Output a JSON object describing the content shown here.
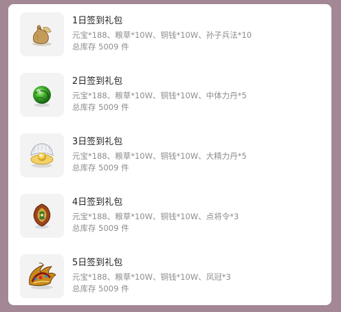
{
  "gifts": [
    {
      "title": "1日签到礼包",
      "contents": "元宝*188、粮草*10W、铜钱*10W、孙子兵法*10",
      "stock": "总库存 5009 件",
      "icon": "grain-sack-icon"
    },
    {
      "title": "2日签到礼包",
      "contents": "元宝*188、粮草*10W、铜钱*10W、中体力丹*5",
      "stock": "总库存 5009 件",
      "icon": "green-pill-icon"
    },
    {
      "title": "3日签到礼包",
      "contents": "元宝*188、粮草*10W、铜钱*10W、大精力丹*5",
      "stock": "总库存 5009 件",
      "icon": "pearl-shell-icon"
    },
    {
      "title": "4日签到礼包",
      "contents": "元宝*188、粮草*10W、铜钱*10W、点将令*3",
      "stock": "总库存 5009 件",
      "icon": "token-badge-icon"
    },
    {
      "title": "5日签到礼包",
      "contents": "元宝*188、粮草*10W、铜钱*10W、凤冠*3",
      "stock": "总库存 5009 件",
      "icon": "phoenix-crown-icon"
    }
  ]
}
